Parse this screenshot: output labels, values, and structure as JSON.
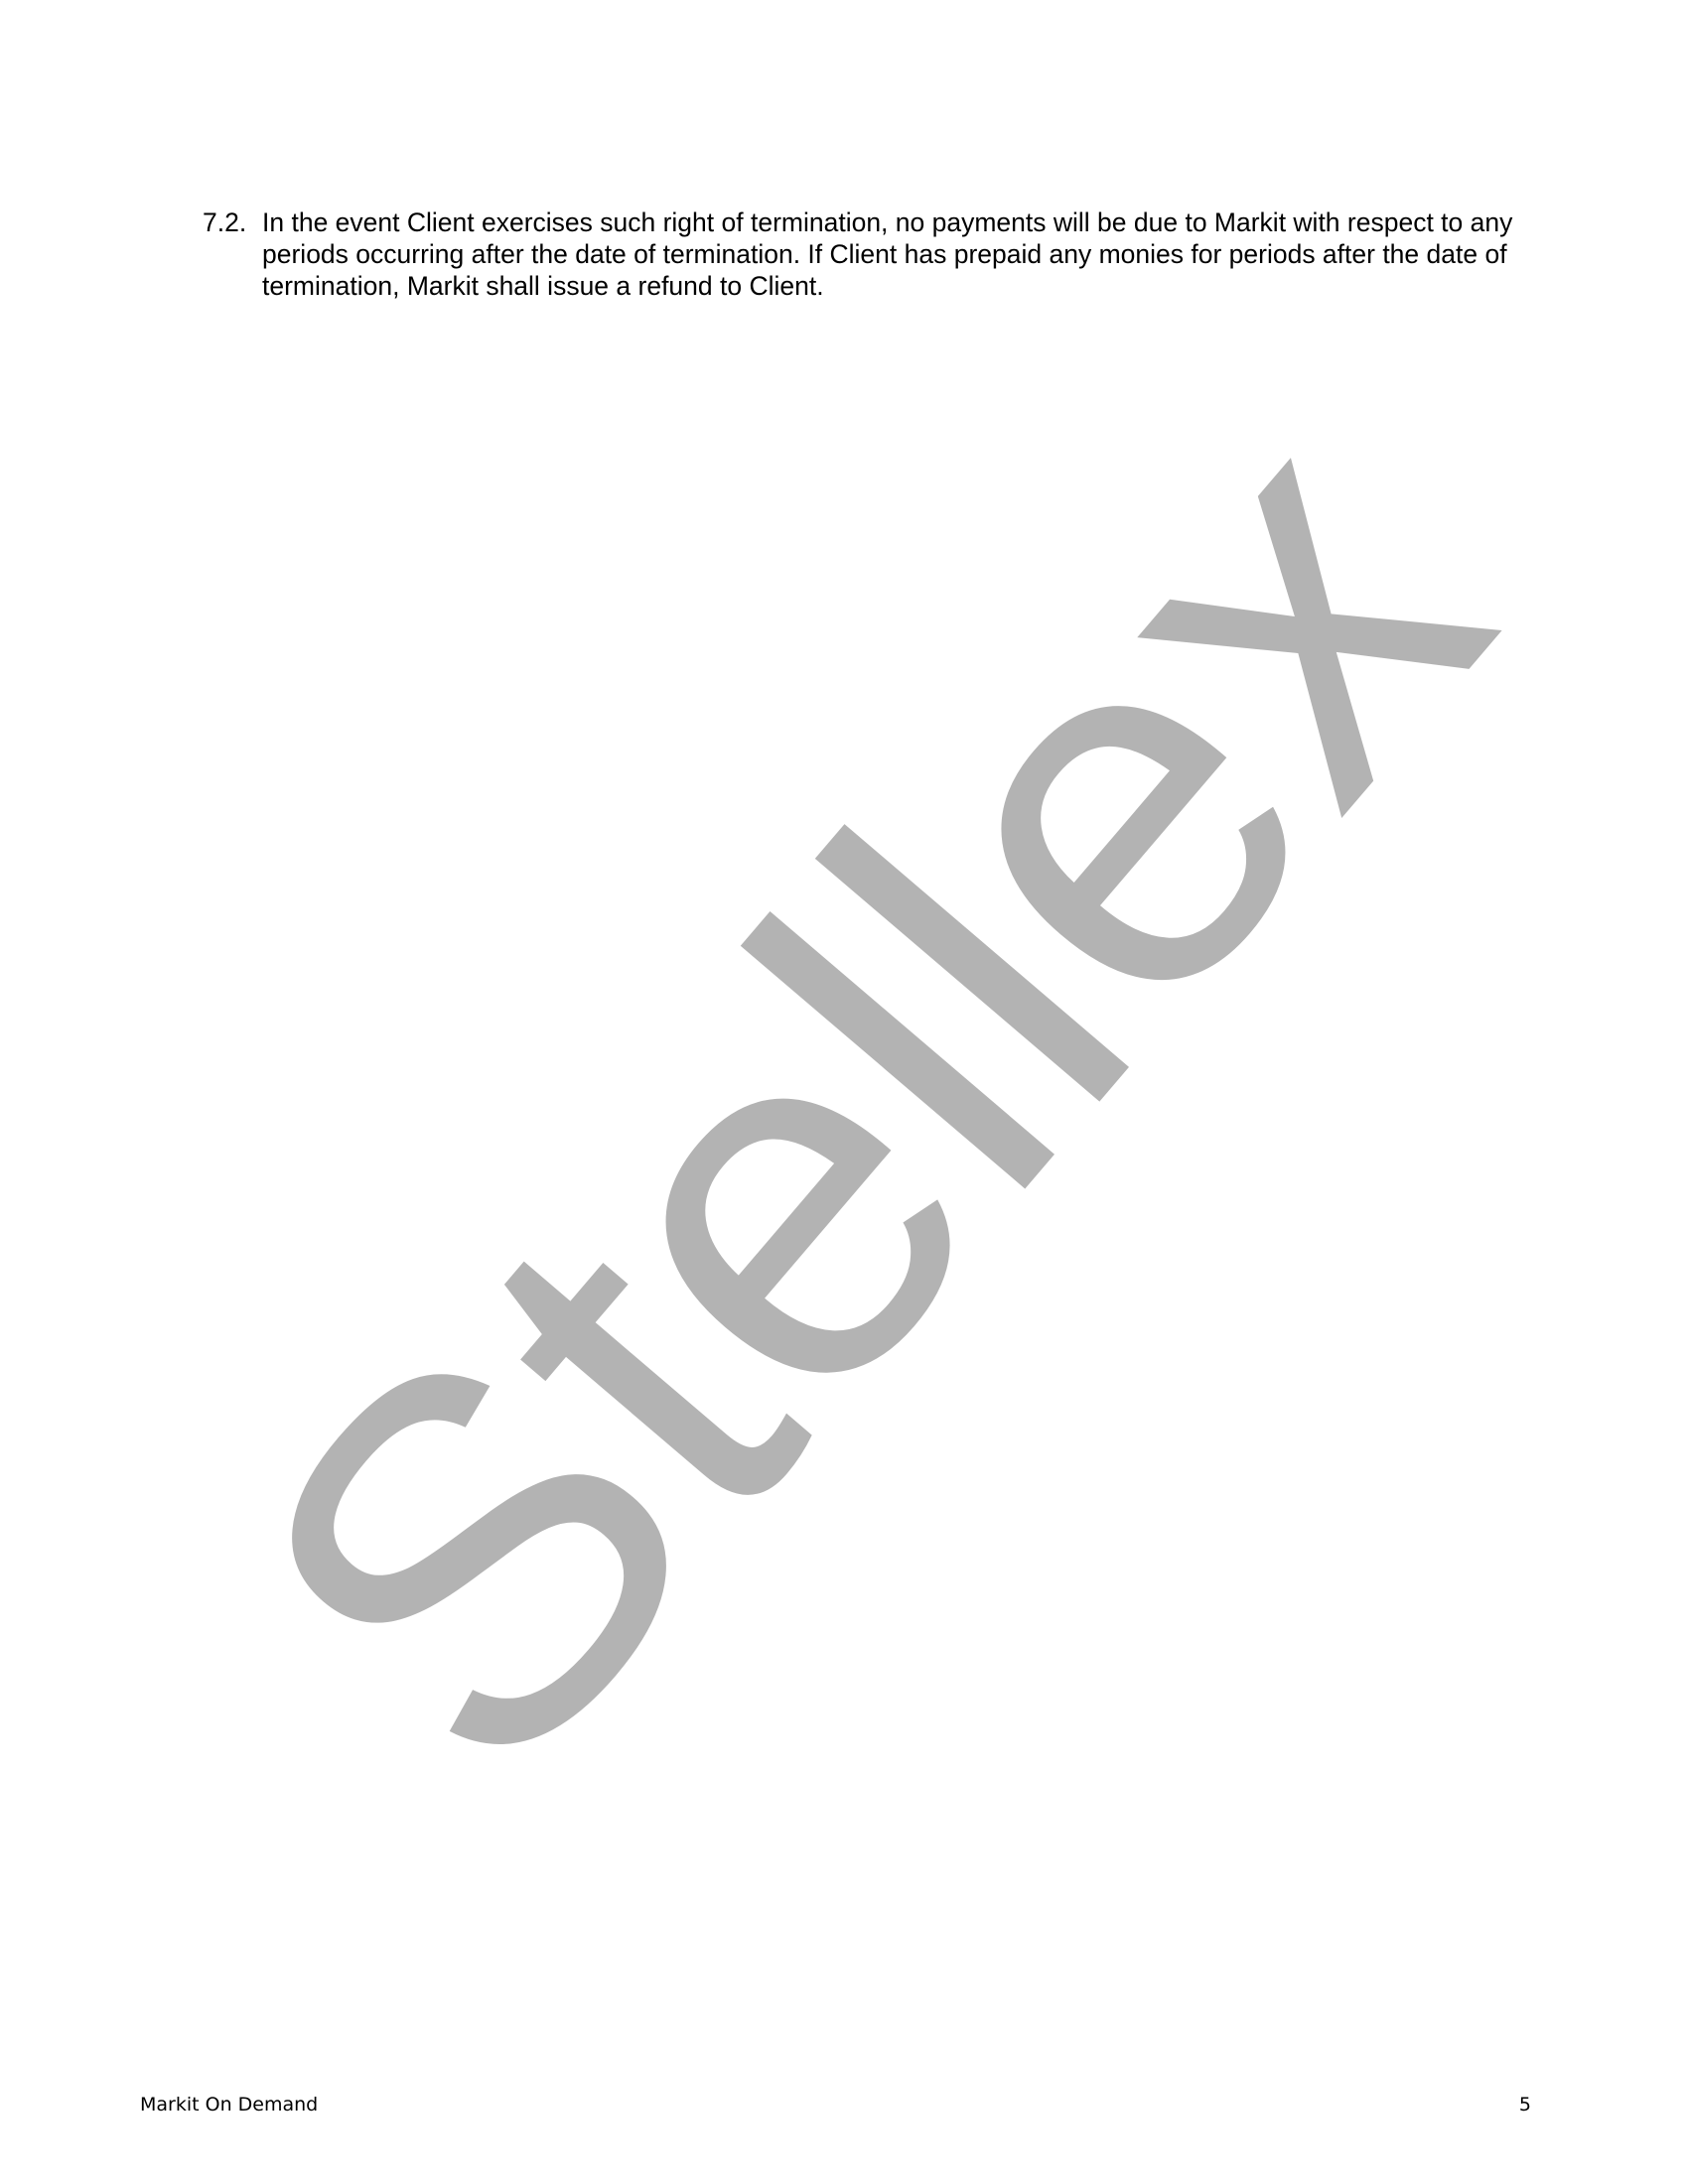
{
  "clause": {
    "number": "7.2.",
    "text": "In the event Client exercises such right of termination, no payments will be due to Markit with respect to any periods occurring after the date of termination. If Client has prepaid any monies for periods after the date of termination, Markit shall issue a refund to Client."
  },
  "watermark": {
    "text": "Stellex",
    "color": "#b3b3b3"
  },
  "footer": {
    "title": "Markit On Demand",
    "page_number": "5"
  }
}
